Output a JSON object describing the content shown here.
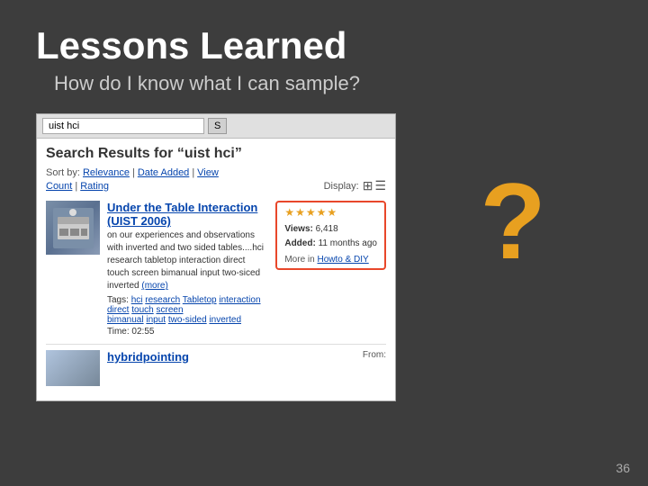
{
  "slide": {
    "background_color": "#3d3d3d",
    "title": "Lessons Learned",
    "subtitle": "How do I know what I can sample?",
    "slide_number": "36"
  },
  "browser": {
    "search_query": "uist hci",
    "search_button_label": "S"
  },
  "search_results": {
    "heading": "Search Results for “uist hci”",
    "sort_label": "Sort by:",
    "sort_options": [
      "Relevance",
      "Date Added",
      "View",
      "Count",
      "Rating"
    ],
    "display_label": "Display:",
    "result1": {
      "title": "Under the Table Interaction (UIST 2006)",
      "description": "on our experiences and observations with inverted and two sided tables....hci research tabletop interaction direct touch screen bimanual input two-siced inverted",
      "more_text": "(more)",
      "tags_label": "Tags:",
      "tags": [
        "hci",
        "research",
        "Tabletop",
        "interaction",
        "direct",
        "touch",
        "screen",
        "bimanual",
        "input",
        "two-sided",
        "inverted"
      ],
      "time_label": "Time:",
      "time_value": "02:55",
      "stars": "★★★★★",
      "views_label": "Views:",
      "views_value": "6,418",
      "added_label": "Added:",
      "added_value": "11 months ago",
      "more_in_label": "More in",
      "more_in_link": "Howto & DIY"
    },
    "result2": {
      "title_prefix": "hybridpointing",
      "from_label": "From:"
    }
  },
  "question_mark": "?",
  "accent_color": "#e8a020",
  "highlight_color": "#e8472a"
}
